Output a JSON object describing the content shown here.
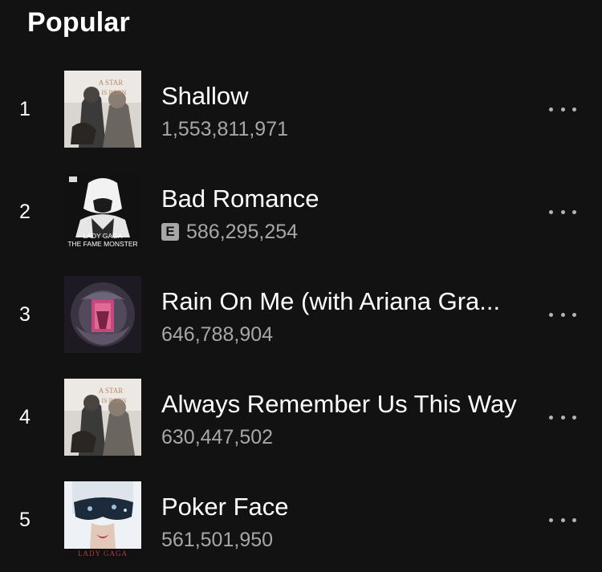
{
  "section": {
    "title": "Popular"
  },
  "tracks": [
    {
      "rank": "1",
      "title": "Shallow",
      "plays": "1,553,811,971",
      "explicit": false,
      "cover_icon": "a-star-is-born-cover"
    },
    {
      "rank": "2",
      "title": "Bad Romance",
      "plays": "586,295,254",
      "explicit": true,
      "explicit_label": "E",
      "cover_icon": "the-fame-monster-cover",
      "cover_text_1": "LADY GAGA",
      "cover_text_2": "THE FAME MONSTER"
    },
    {
      "rank": "3",
      "title": "Rain On Me (with Ariana Gra...",
      "plays": "646,788,904",
      "explicit": false,
      "cover_icon": "chromatica-cover"
    },
    {
      "rank": "4",
      "title": "Always Remember Us This Way",
      "plays": "630,447,502",
      "explicit": false,
      "cover_icon": "a-star-is-born-cover"
    },
    {
      "rank": "5",
      "title": "Poker Face",
      "plays": "561,501,950",
      "explicit": false,
      "cover_icon": "the-fame-cover",
      "cover_text_1": "LADY GAGA"
    }
  ],
  "colors": {
    "background": "#121212",
    "primary_text": "#ffffff",
    "secondary_text": "#a7a7a7"
  }
}
